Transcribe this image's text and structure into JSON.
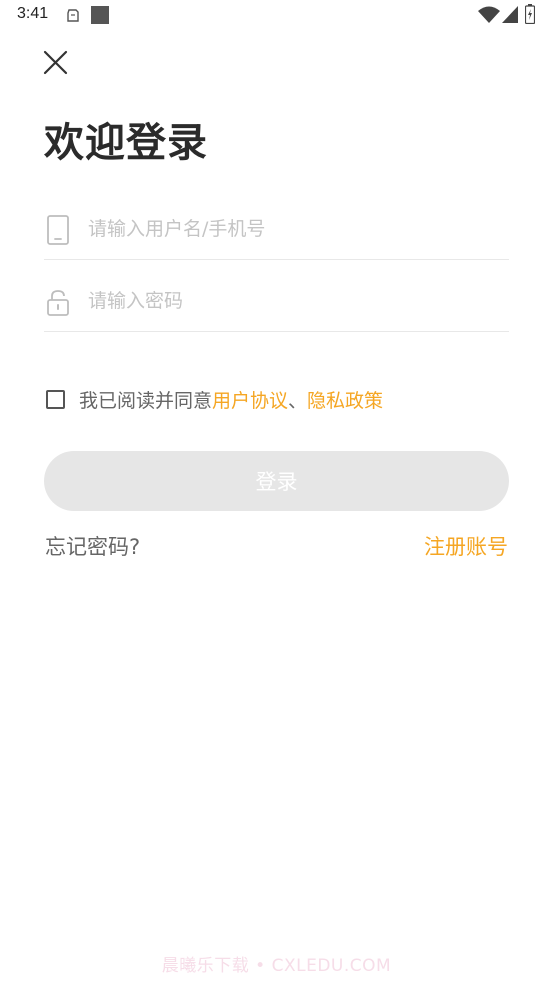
{
  "status_bar": {
    "time": "3:41",
    "icons": [
      "clipboard-icon",
      "square-notification-icon",
      "wifi-icon",
      "signal-icon",
      "battery-icon"
    ]
  },
  "header": {
    "close_icon": "close-icon",
    "title": "欢迎登录"
  },
  "form": {
    "username": {
      "placeholder": "请输入用户名/手机号",
      "value": "",
      "icon": "phone-icon"
    },
    "password": {
      "placeholder": "请输入密码",
      "value": "",
      "icon": "lock-icon"
    }
  },
  "agreement": {
    "checked": false,
    "prefix": "我已阅读并同意",
    "user_agreement": "用户协议",
    "separator": "、",
    "privacy_policy": "隐私政策"
  },
  "login_button": {
    "label": "登录"
  },
  "links": {
    "forgot_password": "忘记密码?",
    "register": "注册账号"
  },
  "watermark": "晨曦乐下载 • CXLEDU.COM",
  "colors": {
    "accent": "#f5a623",
    "button_disabled": "#e6e6e6",
    "title": "#2b2b2b",
    "placeholder": "#c4c4c4"
  }
}
